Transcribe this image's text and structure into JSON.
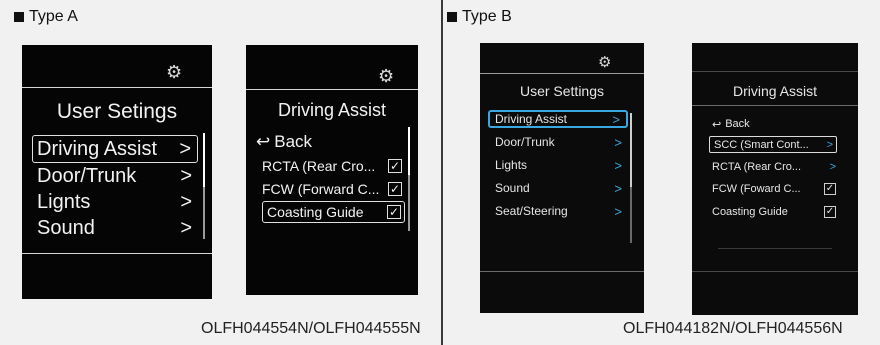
{
  "type_a": {
    "label": "Type A",
    "caption": "OLFH044554N/OLFH044555N",
    "screen1": {
      "gear_icon": "gear-icon",
      "title": "User Setings",
      "items": [
        {
          "label": "Driving Assist",
          "chevron": ">",
          "selected": true
        },
        {
          "label": "Door/Trunk",
          "chevron": ">"
        },
        {
          "label": "Lignts",
          "chevron": ">"
        },
        {
          "label": "Sound",
          "chevron": ">"
        }
      ]
    },
    "screen2": {
      "gear_icon": "gear-icon",
      "title": "Driving Assist",
      "back_label": "Back",
      "items": [
        {
          "label": "RCTA (Rear Cro...",
          "check": "✓"
        },
        {
          "label": "FCW (Forward C...",
          "check": "✓"
        },
        {
          "label": "Coasting Guide",
          "check": "✓",
          "selected": true
        }
      ]
    }
  },
  "type_b": {
    "label": "Type B",
    "caption": "OLFH044182N/OLFH044556N",
    "screen1": {
      "gear_icon": "gear-icon",
      "title": "User Settings",
      "items": [
        {
          "label": "Driving Assist",
          "chevron": ">",
          "selected": true
        },
        {
          "label": "Door/Trunk",
          "chevron": ">"
        },
        {
          "label": "Lights",
          "chevron": ">"
        },
        {
          "label": "Sound",
          "chevron": ">"
        },
        {
          "label": "Seat/Steering",
          "chevron": ">"
        }
      ]
    },
    "screen2": {
      "title": "Driving Assist",
      "back_label": "Back",
      "items": [
        {
          "label": "SCC (Smart Cont...",
          "chevron": ">",
          "selected": true
        },
        {
          "label": "RCTA (Rear Cro...",
          "chevron": ">"
        },
        {
          "label": "FCW (Foward C...",
          "check": "✓"
        },
        {
          "label": "Coasting Guide",
          "check": "✓"
        }
      ]
    }
  },
  "colors": {
    "background": "#f1f1f1",
    "screen": "#050505",
    "accent_blue": "#3aa8e0"
  }
}
